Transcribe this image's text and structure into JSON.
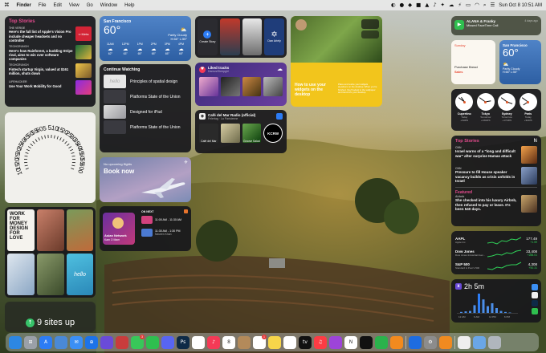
{
  "menubar": {
    "items": [
      "Finder",
      "File",
      "Edit",
      "View",
      "Go",
      "Window",
      "Help"
    ],
    "datetime": "Sun Oct 8  10:51 AM"
  },
  "news_left": {
    "header": "Top Stories",
    "stories": [
      {
        "source": "THE VERGE",
        "headline": "Here's the full list of Apple's Vision Pro include cheaper headsets and no controller"
      },
      {
        "source": "TECHCRUNCH",
        "headline": "Here's how Rainforest, a budding Stripe rival, aims to win over software companies"
      },
      {
        "source": "TECHCRUNCH",
        "headline": "Fintech startup Virgin, valued at $161 million, shuts down"
      },
      {
        "source": "LIFEHACKER",
        "headline": "Use Your Work Mobility for Good"
      }
    ]
  },
  "weather_left": {
    "city": "San Francisco",
    "temp": "60°",
    "condition": "Partly Cloudy",
    "hilo": "H:66° L:55°",
    "forecast": [
      {
        "time": "11AM",
        "temp": "62°"
      },
      {
        "time": "12PM",
        "temp": "63°"
      },
      {
        "time": "1PM",
        "temp": "65°"
      },
      {
        "time": "2PM",
        "temp": "65°"
      },
      {
        "time": "3PM",
        "temp": "65°"
      },
      {
        "time": "4PM",
        "temp": "65°"
      }
    ]
  },
  "podcasts": {
    "tiles": [
      "Create Story",
      "Pod",
      "Pod",
      "Dan Ariely"
    ]
  },
  "photos_top": {
    "text": "How to use your widgets on the desktop",
    "body": "Place and resize your widgets anywhere on the desktop. When you're finished, they'll adapt to the wallpaper and blend into your desktop."
  },
  "continue": {
    "header": "Continue Watching",
    "items": [
      {
        "title": "Principles of spatial design"
      },
      {
        "title": "Platforms State of the Union"
      },
      {
        "title": "Designed for iPad"
      },
      {
        "title": "Platforms State of the Union"
      }
    ]
  },
  "music": {
    "header": "Liked tracks",
    "artist": "Damus/Sleepgirl"
  },
  "radio": {
    "title": "Café del Mar Radio (official)",
    "subtitle": "Felertag · La Parisienne",
    "labels": [
      "Café del Mar",
      "",
      "Groove Salad",
      "KCRW"
    ]
  },
  "clockface": {
    "numbers": [
      "10",
      "15",
      "20",
      "25",
      "30",
      "35",
      "40",
      "45",
      "50",
      "55",
      "60",
      "5",
      "5",
      "10",
      "15",
      "20",
      "25",
      "30",
      "35",
      "40",
      "45",
      "50",
      "55",
      "60",
      "0"
    ]
  },
  "flights": {
    "status": "No upcoming flights",
    "cta": "Book now"
  },
  "calendar": {
    "label": "ON NEXT",
    "events": [
      {
        "time": "11:00 AM - 11:30 AM",
        "title": "Asian Network",
        "sub": "Kam O Mam"
      },
      {
        "time": "11:30 AM - 1:30 PM",
        "title": "",
        "sub": "Naveen Khan"
      }
    ]
  },
  "books": {
    "cover_text": "WORK FOR MONEY DESIGN FOR LOVE",
    "hello": "hello"
  },
  "uptime": {
    "text": "9 sites up"
  },
  "facetime": {
    "name": "ALANA & Franky",
    "status": "Missed FaceTime Call",
    "when": "4 days ago"
  },
  "reminders": {
    "label": "Sunday",
    "sub": "Purchase Bread",
    "sub2": "Sales"
  },
  "weather_right": {
    "city": "San Francisco",
    "temp": "60°",
    "condition": "Partly Cloudy",
    "hilo": "H:66° L:55°"
  },
  "world_clock": {
    "cities": [
      {
        "name": "Cupertino",
        "day": "Today",
        "offset": "+0HRS"
      },
      {
        "name": "Tokyo",
        "day": "Tomorrow",
        "offset": "+16HRS"
      },
      {
        "name": "Sydney",
        "day": "Tomorrow",
        "offset": "+17HRS"
      },
      {
        "name": "Paris",
        "day": "Today",
        "offset": "+9HRS"
      }
    ]
  },
  "news_right": {
    "header": "Top Stories",
    "stories": [
      {
        "source": "CNN",
        "headline": "Israel warns of a \"long and difficult war\" after surprise Hamas attack"
      },
      {
        "source": "CNN",
        "headline": "Pressure to fill House speaker vacancy builds as crisis unfolds in Israel"
      }
    ],
    "featured": {
      "label": "Featured",
      "source": "Airbnb",
      "headline": "She checked into his luxury Airbnb, then refused to pay or leave. It's been 540 days."
    }
  },
  "stocks": [
    {
      "symbol": "AAPL",
      "name": "Apple Inc.",
      "price": "177.49",
      "change": "+1.59"
    },
    {
      "symbol": "Dow Jones",
      "name": "Dow Jones Industrial Aver...",
      "price": "33,408",
      "change": "+288.01"
    },
    {
      "symbol": "S&P 500",
      "name": "Standard & Poor's 500",
      "price": "4,308",
      "change": "+50.31"
    }
  ],
  "screentime": {
    "total": "2h 5m",
    "bars": [
      0.05,
      0.08,
      0.1,
      0.4,
      1.0,
      0.7,
      0.35,
      0.5,
      0.25,
      0.1,
      0.05,
      0.02
    ],
    "axis": [
      "12 AM",
      "6 AM",
      "12 PM",
      "6 PM"
    ]
  },
  "dock": {
    "apps": [
      {
        "name": "Finder",
        "icon": "finder-icon",
        "color": "#2d87e3",
        "glyph": ""
      },
      {
        "name": "Launchpad",
        "icon": "launchpad-icon",
        "color": "#9aa0a8",
        "glyph": "⊞"
      },
      {
        "name": "App Store",
        "icon": "appstore-icon",
        "color": "#2c7cf5",
        "glyph": "A"
      },
      {
        "name": "Preview",
        "icon": "preview-icon",
        "color": "#4a89d6",
        "glyph": ""
      },
      {
        "name": "Mail",
        "icon": "mail-icon",
        "color": "#3b8ff5",
        "glyph": "✉"
      },
      {
        "name": "Safari",
        "icon": "safari-icon",
        "color": "#1c73e8",
        "glyph": "⊕"
      },
      {
        "name": "Arc",
        "icon": "arc-icon",
        "color": "#6a4bd8",
        "glyph": ""
      },
      {
        "name": "Raycast",
        "icon": "raycast-icon",
        "color": "#c93c3c",
        "glyph": ""
      },
      {
        "name": "Messages",
        "icon": "messages-icon",
        "color": "#38c759",
        "glyph": "",
        "badge": "3"
      },
      {
        "name": "FaceTime",
        "icon": "facetime-icon",
        "color": "#2fbf4f",
        "glyph": ""
      },
      {
        "name": "Discord",
        "icon": "discord-icon",
        "color": "#5865f2",
        "glyph": ""
      },
      {
        "name": "Photoshop",
        "icon": "photoshop-icon",
        "color": "#0e2a47",
        "glyph": "Ps"
      },
      {
        "name": "Photos",
        "icon": "photos-icon",
        "color": "#ffffff",
        "glyph": ""
      },
      {
        "name": "Music",
        "icon": "music-icon",
        "color": "#f43a56",
        "glyph": "♪"
      },
      {
        "name": "Calendar",
        "icon": "calendar-icon",
        "color": "#ffffff",
        "glyph": "8"
      },
      {
        "name": "Contacts",
        "icon": "contacts-icon",
        "color": "#b38a5a",
        "glyph": ""
      },
      {
        "name": "Reminders",
        "icon": "reminders-icon",
        "color": "#ffffff",
        "glyph": "",
        "badge": "1"
      },
      {
        "name": "Notes",
        "icon": "notes-icon",
        "color": "#f7d54a",
        "glyph": ""
      },
      {
        "name": "Freeform",
        "icon": "freeform-icon",
        "color": "#ffffff",
        "glyph": ""
      },
      {
        "name": "TV",
        "icon": "tv-icon",
        "color": "#111111",
        "glyph": "tv"
      },
      {
        "name": "Music 2",
        "icon": "itunes-icon",
        "color": "#fc3c44",
        "glyph": "♫"
      },
      {
        "name": "Podcasts",
        "icon": "podcasts-icon",
        "color": "#9d44d9",
        "glyph": ""
      },
      {
        "name": "News",
        "icon": "news-icon",
        "color": "#ffffff",
        "glyph": "N"
      },
      {
        "name": "Stocks",
        "icon": "stocks-icon",
        "color": "#111111",
        "glyph": ""
      },
      {
        "name": "Numbers",
        "icon": "numbers-icon",
        "color": "#2bb24c",
        "glyph": ""
      },
      {
        "name": "Pages",
        "icon": "pages-icon",
        "color": "#f28a1e",
        "glyph": ""
      },
      {
        "name": "Keynote",
        "icon": "keynote-icon",
        "color": "#1d6ce0",
        "glyph": ""
      },
      {
        "name": "Settings",
        "icon": "settings-icon",
        "color": "#8c8c8c",
        "glyph": "⚙"
      },
      {
        "name": "Books",
        "icon": "books-icon",
        "color": "#f08a20",
        "glyph": ""
      },
      {
        "name": "Document",
        "icon": "document-icon",
        "color": "#eeeeee",
        "glyph": ""
      },
      {
        "name": "Downloads",
        "icon": "downloads-icon",
        "color": "#6aa6e6",
        "glyph": ""
      },
      {
        "name": "Trash",
        "icon": "trash-icon",
        "color": "#b0b6bd",
        "glyph": ""
      }
    ]
  }
}
